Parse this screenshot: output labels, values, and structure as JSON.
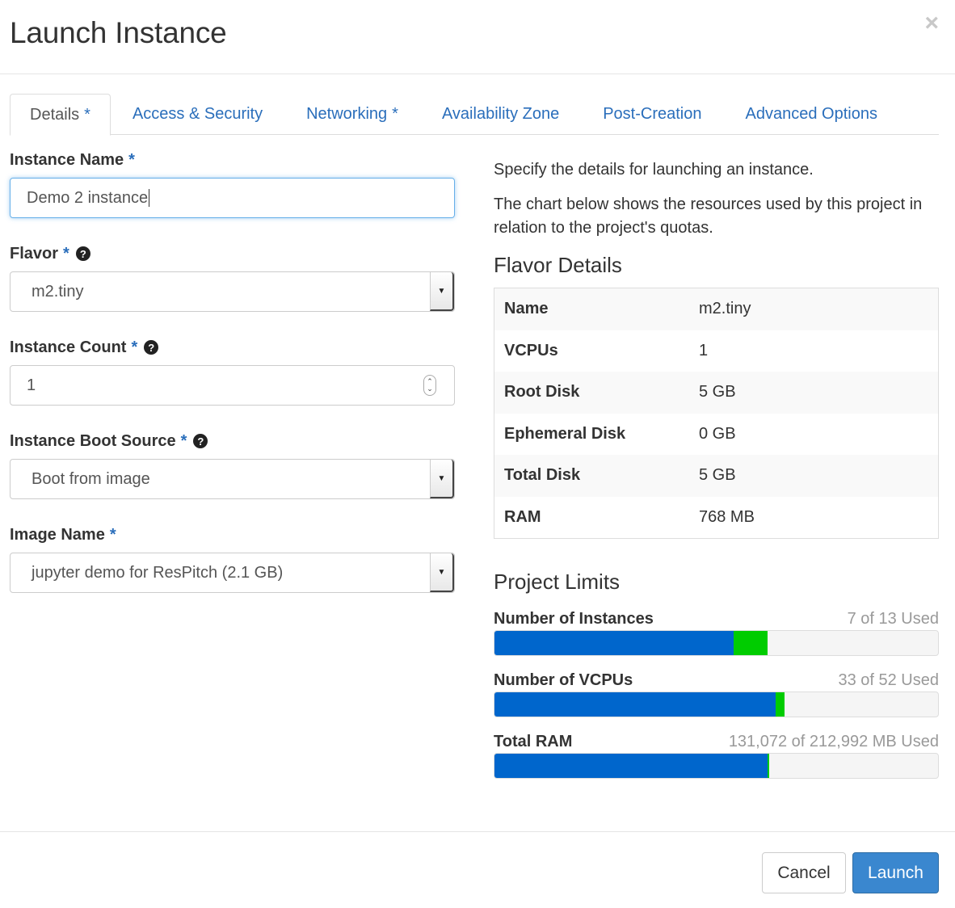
{
  "dialog": {
    "title": "Launch Instance",
    "close_label": "×"
  },
  "tabs": [
    {
      "label": "Details",
      "required": "*"
    },
    {
      "label": "Access & Security",
      "required": ""
    },
    {
      "label": "Networking",
      "required": "*"
    },
    {
      "label": "Availability Zone",
      "required": ""
    },
    {
      "label": "Post-Creation",
      "required": ""
    },
    {
      "label": "Advanced Options",
      "required": ""
    }
  ],
  "form": {
    "instance_name": {
      "label": "Instance Name",
      "required": "*",
      "value": "Demo 2 instance"
    },
    "flavor": {
      "label": "Flavor",
      "required": "*",
      "value": "m2.tiny"
    },
    "instance_count": {
      "label": "Instance Count",
      "required": "*",
      "value": "1"
    },
    "boot_source": {
      "label": "Instance Boot Source",
      "required": "*",
      "value": "Boot from image"
    },
    "image_name": {
      "label": "Image Name",
      "required": "*",
      "value": "jupyter demo for ResPitch (2.1 GB)"
    },
    "help_icon": "?"
  },
  "info": {
    "desc1": "Specify the details for launching an instance.",
    "desc2": "The chart below shows the resources used by this project in relation to the project's quotas."
  },
  "flavor_details": {
    "heading": "Flavor Details",
    "rows": [
      {
        "key": "Name",
        "value": "m2.tiny"
      },
      {
        "key": "VCPUs",
        "value": "1"
      },
      {
        "key": "Root Disk",
        "value": "5 GB"
      },
      {
        "key": "Ephemeral Disk",
        "value": "0 GB"
      },
      {
        "key": "Total Disk",
        "value": "5 GB"
      },
      {
        "key": "RAM",
        "value": "768 MB"
      }
    ]
  },
  "project_limits": {
    "heading": "Project Limits",
    "items": [
      {
        "name": "Number of Instances",
        "used_text": "7 of 13 Used",
        "used": 7,
        "added": 1,
        "total": 13
      },
      {
        "name": "Number of VCPUs",
        "used_text": "33 of 52 Used",
        "used": 33,
        "added": 1,
        "total": 52
      },
      {
        "name": "Total RAM",
        "used_text": "131,072 of 212,992 MB Used",
        "used": 131072,
        "added": 768,
        "total": 212992
      }
    ]
  },
  "colors": {
    "used": "#0066cc",
    "added": "#00cc00",
    "link": "#2a6ebb",
    "primary": "#3a87cf"
  },
  "footer": {
    "cancel_label": "Cancel",
    "launch_label": "Launch"
  }
}
